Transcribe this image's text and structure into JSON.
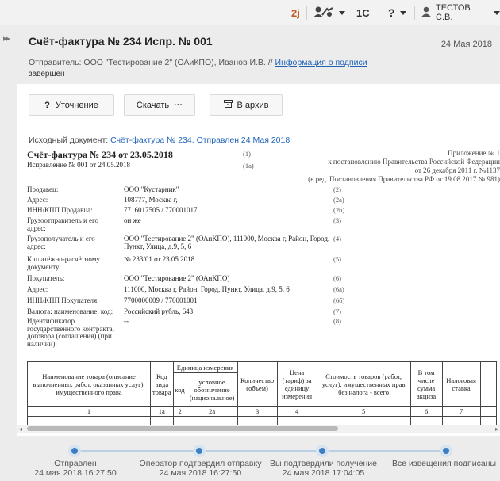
{
  "topbar": {
    "logo_label": "2j",
    "logo_color": "#c2581a",
    "onec_label": "1С",
    "help_label": "?",
    "user_label": "ТЕСТОВ С.В."
  },
  "header": {
    "title": "Счёт-фактура № 234 Испр. № 001",
    "date": "24 Мая 2018",
    "sender": "Отправитель: ООО \"Тестирование 2\" (ОАиКПО),  Иванов И.В.  //",
    "signature_link": "Информация о подписи",
    "status": "завершен"
  },
  "actions": {
    "clarify": "Уточнение",
    "download": "Скачать",
    "archive": "В архив"
  },
  "source": {
    "label": "Исходный документ:",
    "link": "Счёт-фактура № 234. Отправлен 24 Мая 2018"
  },
  "doc": {
    "title": "Счёт-фактура № 234 от 23.05.2018",
    "title_num": "(1)",
    "correction": "Исправление № 001 от 24.05.2018",
    "correction_num": "(1а)",
    "appendix": [
      "Приложение № 1",
      "к постановлению Правительства Российской Федерации",
      "от 26 декабря 2011 г. №1137",
      "(в ред. Постановления Правительства РФ от 19.08.2017 № 981)"
    ],
    "fields": [
      {
        "label": "Продавец:",
        "value": "ООО \"Кустарник\"",
        "num": "(2)"
      },
      {
        "label": "Адрес:",
        "value": "108777, Москва г,",
        "num": "(2а)"
      },
      {
        "label": "ИНН/КПП Продавца:",
        "value": "7716017505 / 770001017",
        "num": "(2б)"
      },
      {
        "label": "Грузоотправитель и его адрес:",
        "value": "он же",
        "num": "(3)"
      },
      {
        "label": "Грузополучатель и его адрес:",
        "value": "ООО \"Тестирование 2\" (ОАиКПО), 111000, Москва г, Район, Город, Пункт, Улица, д.9, 5, 6",
        "num": "(4)"
      },
      {
        "label": "К платёжно-расчётному документу:",
        "value": "№ 233/01 от 23.05.2018",
        "num": "(5)"
      },
      {
        "label": "Покупатель:",
        "value": "ООО \"Тестирование 2\" (ОАиКПО)",
        "num": "(6)"
      },
      {
        "label": "Адрес:",
        "value": "111000, Москва г, Район, Город, Пункт, Улица, д.9, 5, 6",
        "num": "(6а)"
      },
      {
        "label": "ИНН/КПП Покупателя:",
        "value": "7700000009 / 770001001",
        "num": "(6б)"
      },
      {
        "label": "Валюта: наименование, код:",
        "value": "Российский рубль, 643",
        "num": "(7)"
      },
      {
        "label": "Идентификатор государственного контракта, договора (соглашения) (при наличии):",
        "value": "--",
        "num": "(8)"
      }
    ],
    "table": {
      "h_name": "Наименование товара (описание выполненных работ, оказанных услуг), имущественного права",
      "h_type": "Код вида товара",
      "h_unit": "Единица измерения",
      "h_unit_code": "код",
      "h_unit_name": "условное обозначение (национальное)",
      "h_qty": "Количество (объем)",
      "h_price": "Цена (тариф) за единицу измерения",
      "h_cost": "Стоимость товаров (работ, услуг), имущественных прав без налога - всего",
      "h_excise": "В том числе сумма акциза",
      "h_rate": "Налоговая ставка",
      "nums": [
        "1",
        "1а",
        "2",
        "2а",
        "3",
        "4",
        "5",
        "6",
        "7"
      ]
    }
  },
  "timeline": [
    {
      "label": "Отправлен",
      "date": "24 мая 2018 16:27:50"
    },
    {
      "label": "Оператор подтвердил отправку",
      "date": "24 мая 2018 16:27:50"
    },
    {
      "label": "Вы подтвердили получение",
      "date": "24 мая 2018 17:04:05"
    },
    {
      "label": "Все извещения подписаны",
      "date": ""
    }
  ]
}
